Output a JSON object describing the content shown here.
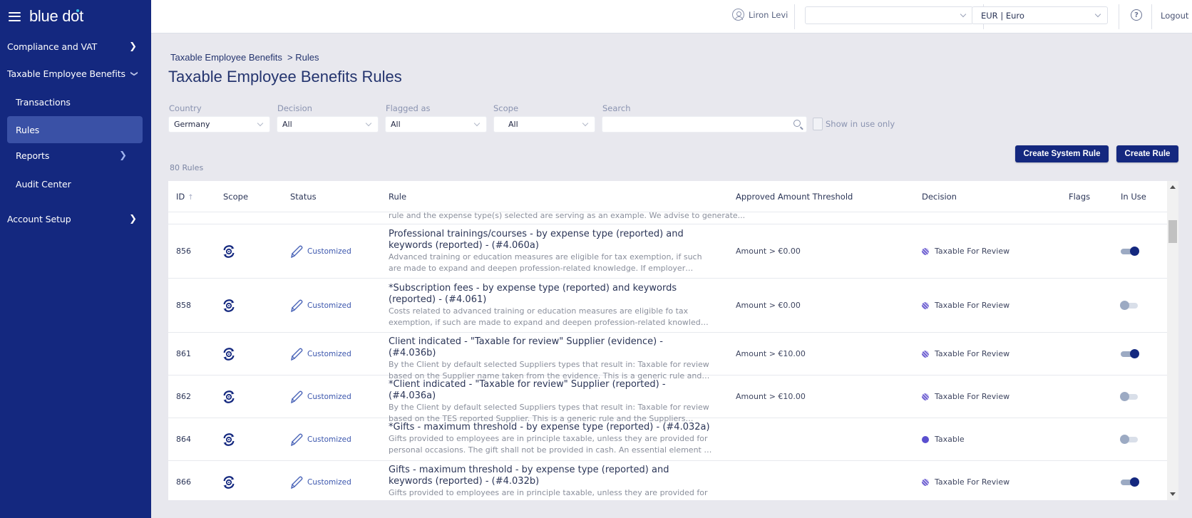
{
  "app": {
    "brand": "blue dot"
  },
  "sidebar": {
    "items": [
      {
        "label": "Compliance and VAT",
        "chevron": "right"
      },
      {
        "label": "Taxable Employee Benefits",
        "chevron": "down"
      },
      {
        "label": "Transactions"
      },
      {
        "label": "Rules",
        "active": true
      },
      {
        "label": "Reports",
        "chevron": "right"
      },
      {
        "label": "Audit Center"
      },
      {
        "label": "Account Setup",
        "chevron": "right"
      }
    ]
  },
  "topbar": {
    "user": "Liron Levi",
    "entity_select": {
      "value": ""
    },
    "currency_select": {
      "value": "EUR | Euro"
    },
    "help_icon": "?",
    "logout": "Logout"
  },
  "breadcrumb": {
    "parent": "Taxable Employee Benefits",
    "current": "> Rules"
  },
  "page_title": "Taxable Employee Benefits Rules",
  "filters": {
    "country": {
      "label": "Country",
      "value": "Germany"
    },
    "decision": {
      "label": "Decision",
      "value": "All"
    },
    "flagged": {
      "label": "Flagged as",
      "value": "All"
    },
    "scope": {
      "label": "Scope",
      "value": "All"
    },
    "search": {
      "label": "Search",
      "value": "",
      "placeholder": ""
    },
    "in_use_only": {
      "label": "Show in use only",
      "checked": false
    }
  },
  "buttons": {
    "create_system_rule": "Create System Rule",
    "create_rule": "Create Rule"
  },
  "rules_count": "80 Rules",
  "table": {
    "columns": {
      "id": "ID",
      "scope": "Scope",
      "status": "Status",
      "rule": "Rule",
      "threshold": "Approved Amount Threshold",
      "decision": "Decision",
      "flags": "Flags",
      "in_use": "In Use"
    },
    "sort": {
      "column": "ID",
      "direction": "ascending"
    },
    "partial_row_desc": "rule and the expense type(s) selected are serving as an example. We advise to generate...",
    "rows": [
      {
        "id": "856",
        "status": "Customized",
        "title": "Professional trainings/courses - by expense type (reported) and keywords (reported) - (#4.060a)",
        "desc": "Advanced training or education measures are eligible for tax exemption, if such are made to expand and deepen profession-related knowledge. If employer initiates such...",
        "threshold": "Amount > €0.00",
        "decision": "Taxable For Review",
        "decision_type": "review",
        "flags": "",
        "in_use": true
      },
      {
        "id": "858",
        "status": "Customized",
        "title": "*Subscription fees - by expense type (reported) and keywords (reported) - (#4.061)",
        "desc": "Costs related to advanced training or education measures are eligible fo tax exemption, if such are made to expand and deepen profession-related knowledge. If employer...",
        "threshold": "Amount > €0.00",
        "decision": "Taxable For Review",
        "decision_type": "review",
        "flags": "",
        "in_use": false
      },
      {
        "id": "861",
        "status": "Customized",
        "title": "Client indicated - \"Taxable for review\" Supplier (evidence) - (#4.036b)",
        "desc": "By the Client by default selected Suppliers types that result in: Taxable for review based on the Supplier name taken from the evidence. This is a generic rule and the Suppliers...",
        "threshold": "Amount > €10.00",
        "decision": "Taxable For Review",
        "decision_type": "review",
        "flags": "",
        "in_use": true
      },
      {
        "id": "862",
        "status": "Customized",
        "title": "*Client indicated - \"Taxable for review\" Supplier (reported) - (#4.036a)",
        "desc": "By the Client by default selected Suppliers types that result in: Taxable for review based on the TES reported Supplier. This is a generic rule and the Suppliers selected are servi...",
        "threshold": "Amount > €10.00",
        "decision": "Taxable For Review",
        "decision_type": "review",
        "flags": "",
        "in_use": false
      },
      {
        "id": "864",
        "status": "Customized",
        "title": "*Gifts - maximum threshold - by expense type (reported) - (#4.032a)",
        "desc": "Gifts provided to employees are in principle taxable, unless they are provided for personal occasions. The gift shall not be provided in cash. An essential element of such...",
        "threshold": "",
        "decision": "Taxable",
        "decision_type": "taxable",
        "flags": "",
        "in_use": false
      },
      {
        "id": "866",
        "status": "Customized",
        "title": "Gifts - maximum threshold - by expense type (reported) and keywords (reported) - (#4.032b)",
        "desc": "Gifts provided to employees are in principle taxable, unless they are provided for",
        "threshold": "",
        "decision": "Taxable For Review",
        "decision_type": "review",
        "flags": "",
        "in_use": true
      }
    ]
  },
  "colors": {
    "sidebar_bg": "#14287f",
    "accent": "#14287f",
    "active_nav": "#3a51a6",
    "taxable": "#5a4fcf",
    "review": "#6a5ccf"
  }
}
